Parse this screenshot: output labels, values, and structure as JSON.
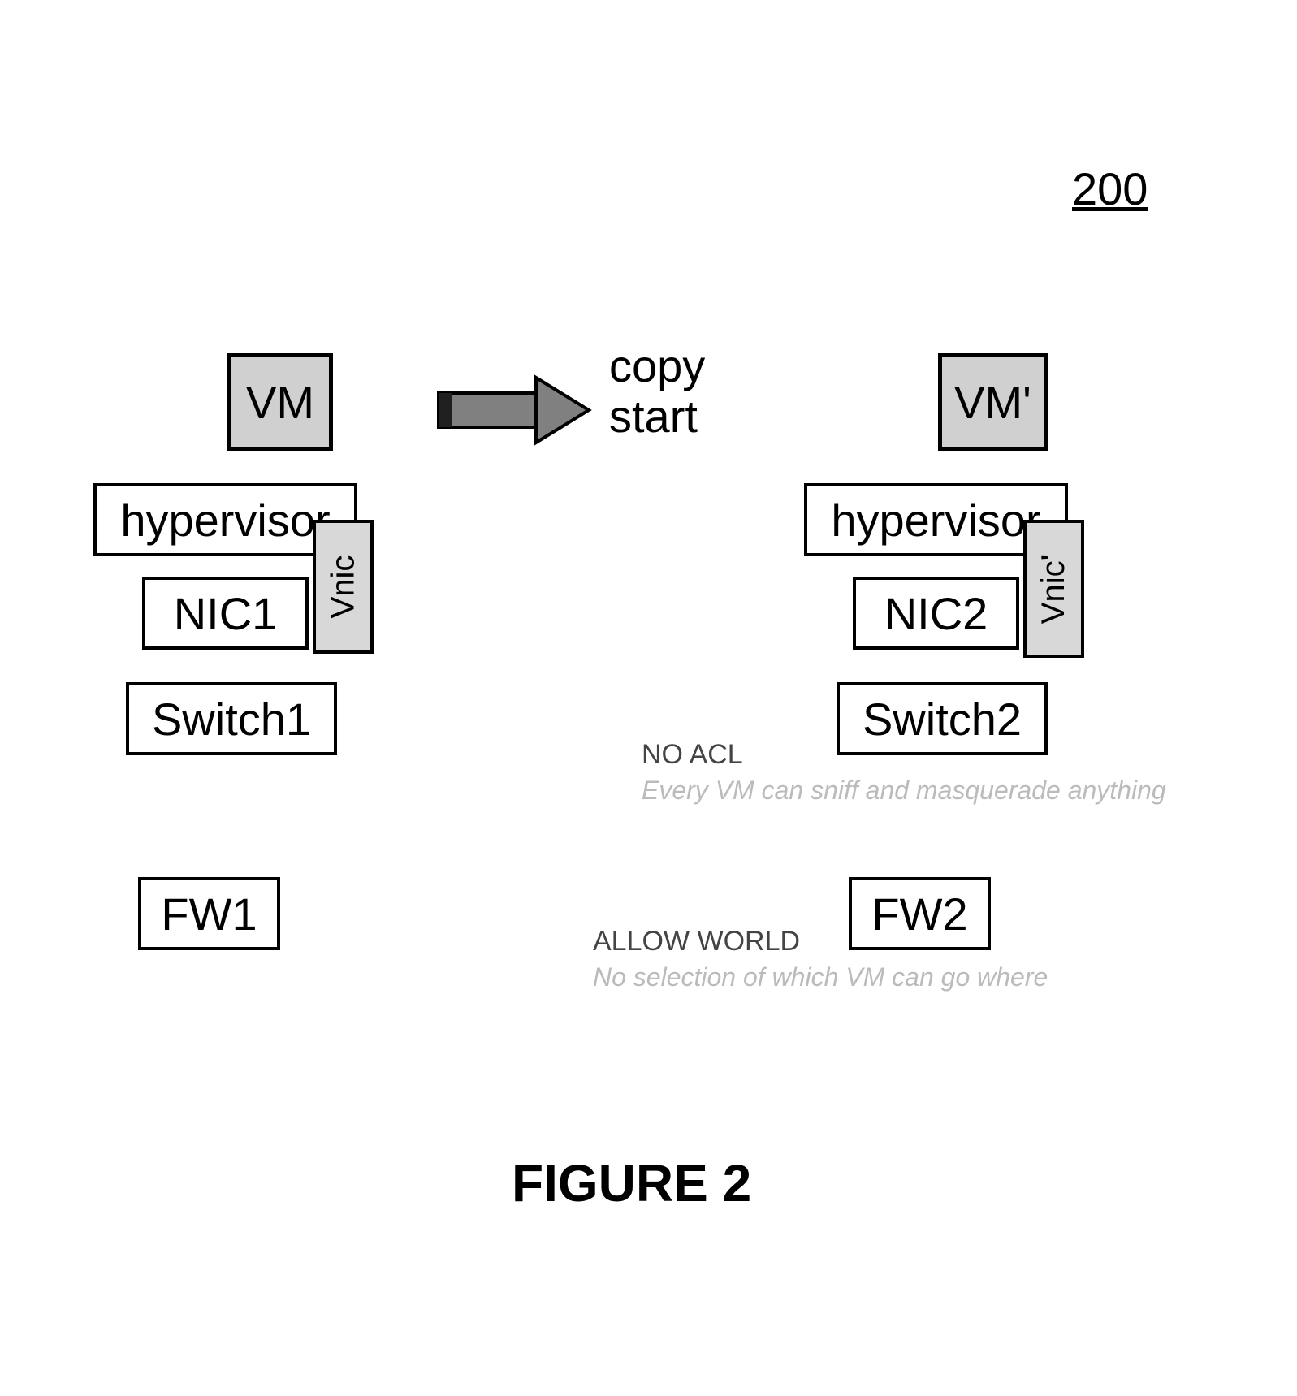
{
  "ref_number": "200",
  "fig_label": "FIGURE 2",
  "copy_label_line1": "copy",
  "copy_label_line2": "start",
  "left_stack": {
    "vm": "VM",
    "hypervisor": "hypervisor",
    "nic": "NIC1",
    "vnic": "Vnic",
    "switch": "Switch1",
    "fw": "FW1"
  },
  "right_stack": {
    "vm": "VM'",
    "hypervisor": "hypervisor",
    "nic": "NIC2",
    "vnic": "Vnic'",
    "switch": "Switch2",
    "fw": "FW2"
  },
  "annot1_head": "NO ACL",
  "annot1_sub": "Every VM can sniff and masquerade anything",
  "annot2_head": "ALLOW WORLD",
  "annot2_sub": "No selection of which VM can go where"
}
